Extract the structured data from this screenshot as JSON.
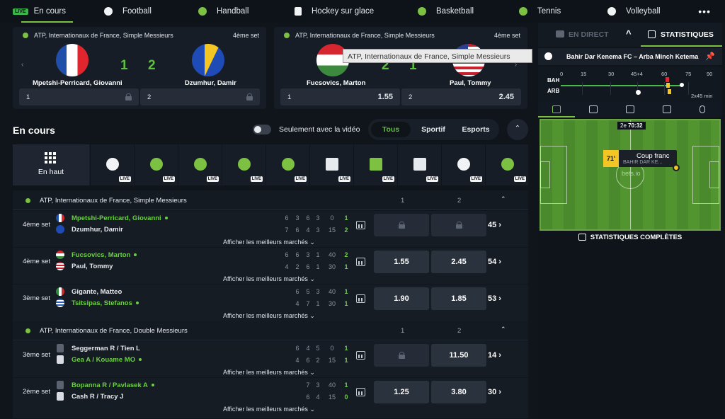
{
  "nav": {
    "live_badge": "LIVE",
    "tabs": [
      "En cours",
      "Football",
      "Handball",
      "Hockey sur glace",
      "Basketball",
      "Tennis",
      "Volleyball"
    ],
    "more": "•••"
  },
  "featured": [
    {
      "competition": "ATP, Internationaux de France, Simple Messieurs",
      "set": "4ème set",
      "player1": "Mpetshi-Perricard, Giovanni",
      "player2": "Dzumhur, Damir",
      "score1": "1",
      "score2": "2",
      "odd1_label": "1",
      "odd2_label": "2"
    },
    {
      "competition": "ATP, Internationaux de France, Simple Messieurs",
      "set": "4ème set",
      "player1": "Fucsovics, Marton",
      "player2": "Paul, Tommy",
      "score1": "2",
      "score2": "1",
      "odd1_label": "1",
      "odd1_value": "1.55",
      "odd2_label": "2",
      "odd2_value": "2.45"
    }
  ],
  "tooltip": "ATP, Internationaux de France, Simple Messieurs",
  "section": {
    "title": "En cours",
    "video_toggle": "Seulement avec la vidéo",
    "filters": [
      "Tous",
      "Sportif",
      "Esports"
    ],
    "top_tile": "En haut",
    "tile_live": "LIVE"
  },
  "groups": [
    {
      "competition": "ATP, Internationaux de France, Simple Messieurs",
      "col1": "1",
      "col2": "2",
      "rows": [
        {
          "set": "4ème set",
          "p1": "Mpetshi-Perricard, Giovanni",
          "p2": "Dzumhur, Damir",
          "s1": [
            "6",
            "3",
            "6",
            "3",
            "0",
            "1"
          ],
          "s2": [
            "7",
            "6",
            "4",
            "3",
            "15",
            "2"
          ],
          "o1": "",
          "o2": "",
          "markets": "45",
          "more": "Afficher les meilleurs marchés"
        },
        {
          "set": "4ème set",
          "p1": "Fucsovics, Marton",
          "p2": "Paul, Tommy",
          "s1": [
            "6",
            "6",
            "3",
            "1",
            "40",
            "2"
          ],
          "s2": [
            "4",
            "2",
            "6",
            "1",
            "30",
            "1"
          ],
          "o1": "1.55",
          "o2": "2.45",
          "markets": "54",
          "more": "Afficher les meilleurs marchés"
        },
        {
          "set": "3ème set",
          "p1": "Gigante, Matteo",
          "p2": "Tsitsipas, Stefanos",
          "s1": [
            "6",
            "5",
            "3",
            "40",
            "1"
          ],
          "s2": [
            "4",
            "7",
            "1",
            "30",
            "1"
          ],
          "o1": "1.90",
          "o2": "1.85",
          "markets": "53",
          "more": "Afficher les meilleurs marchés"
        }
      ]
    },
    {
      "competition": "ATP, Internationaux de France, Double Messieurs",
      "col1": "1",
      "col2": "2",
      "rows": [
        {
          "set": "3ème set",
          "p1": "Seggerman R / Tien L",
          "p2": "Gea A / Kouame MO",
          "s1": [
            "6",
            "4",
            "5",
            "0",
            "1"
          ],
          "s2": [
            "4",
            "6",
            "2",
            "15",
            "1"
          ],
          "o1": "",
          "o2": "11.50",
          "markets": "14",
          "more": "Afficher les meilleurs marchés"
        },
        {
          "set": "2ème set",
          "p1": "Bopanna R / Pavlasek A",
          "p2": "Cash R / Tracy J",
          "s1": [
            "7",
            "3",
            "40",
            "1"
          ],
          "s2": [
            "6",
            "4",
            "15",
            "0"
          ],
          "o1": "1.25",
          "o2": "3.80",
          "markets": "30",
          "more": "Afficher les meilleurs marchés"
        }
      ]
    }
  ],
  "right_panel": {
    "live_label": "EN DIRECT",
    "stats_label": "STATISTIQUES",
    "match": "Bahir Dar Kenema FC – Arba Minch Ketema",
    "timeline_ticks": [
      "0",
      "15",
      "30",
      "45+4",
      "60",
      "75",
      "90"
    ],
    "team1": "BAH",
    "team2": "ARB",
    "extra": "2x45 min",
    "half": "2e",
    "clock": "70:32",
    "event_minute": "71'",
    "event_title": "Coup franc",
    "event_team": "BAHIR DAR KE...",
    "watermark": "bets.io",
    "full_stats": "STATISTIQUES COMPLÈTES"
  }
}
